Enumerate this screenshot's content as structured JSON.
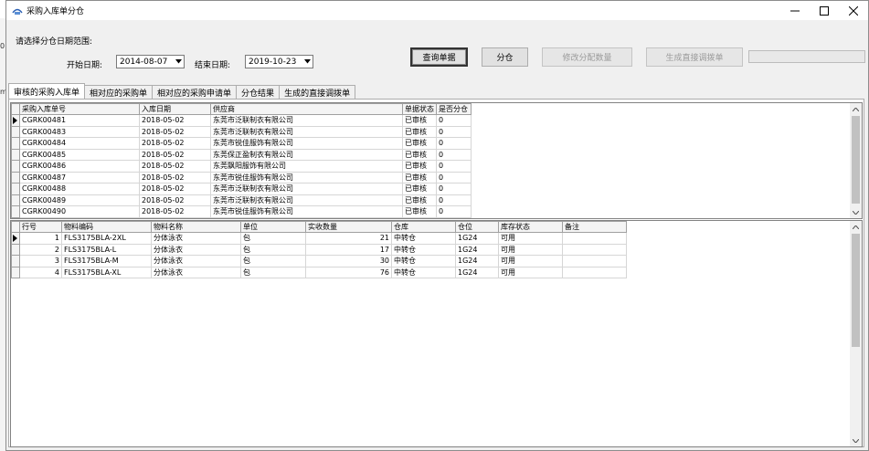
{
  "window": {
    "title": "采购入库单分仓",
    "minimize": "—",
    "maximize": "☐",
    "close": "✕"
  },
  "edge_fragments": [
    "0",
    "m"
  ],
  "filter": {
    "range_label": "请选择分仓日期范围:",
    "start_label": "开始日期:",
    "start_value": "2014-08-07",
    "end_label": "结束日期:",
    "end_value": "2019-10-23"
  },
  "buttons": {
    "query": "查询单据",
    "allocate": "分仓",
    "modify_qty": "修改分配数量",
    "generate_transfer": "生成直接调拨单"
  },
  "tabs": [
    {
      "label": "审核的采购入库单",
      "active": true
    },
    {
      "label": "相对应的采购单",
      "active": false
    },
    {
      "label": "相对应的采购申请单",
      "active": false
    },
    {
      "label": "分仓结果",
      "active": false
    },
    {
      "label": "生成的直接调拨单",
      "active": false
    }
  ],
  "receipts": {
    "columns": [
      "采购入库单号",
      "入库日期",
      "供应商",
      "单据状态",
      "是否分仓"
    ],
    "rows": [
      [
        "CGRK00481",
        "2018-05-02",
        "东莞市泛联制衣有限公司",
        "已审核",
        "0"
      ],
      [
        "CGRK00483",
        "2018-05-02",
        "东莞市泛联制衣有限公司",
        "已审核",
        "0"
      ],
      [
        "CGRK00484",
        "2018-05-02",
        "东莞市锐佳服饰有限公司",
        "已审核",
        "0"
      ],
      [
        "CGRK00485",
        "2018-05-02",
        "东莞保正盈制衣有限公司",
        "已审核",
        "0"
      ],
      [
        "CGRK00486",
        "2018-05-02",
        "东莞飘阳服饰有限公司",
        "已审核",
        "0"
      ],
      [
        "CGRK00487",
        "2018-05-02",
        "东莞市锐佳服饰有限公司",
        "已审核",
        "0"
      ],
      [
        "CGRK00488",
        "2018-05-02",
        "东莞市泛联制衣有限公司",
        "已审核",
        "0"
      ],
      [
        "CGRK00489",
        "2018-05-02",
        "东莞市泛联制衣有限公司",
        "已审核",
        "0"
      ],
      [
        "CGRK00490",
        "2018-05-02",
        "东莞市锐佳服饰有限公司",
        "已审核",
        "0"
      ]
    ]
  },
  "details": {
    "columns": [
      "行号",
      "物料编码",
      "物料名称",
      "单位",
      "实收数量",
      "仓库",
      "仓位",
      "库存状态",
      "备注"
    ],
    "rows": [
      [
        "1",
        "FLS3175BLA-2XL",
        "分体泳衣",
        "包",
        "21",
        "中转仓",
        "1G24",
        "可用",
        ""
      ],
      [
        "2",
        "FLS3175BLA-L",
        "分体泳衣",
        "包",
        "17",
        "中转仓",
        "1G24",
        "可用",
        ""
      ],
      [
        "3",
        "FLS3175BLA-M",
        "分体泳衣",
        "包",
        "30",
        "中转仓",
        "1G24",
        "可用",
        ""
      ],
      [
        "4",
        "FLS3175BLA-XL",
        "分体泳衣",
        "包",
        "76",
        "中转仓",
        "1G24",
        "可用",
        ""
      ]
    ]
  },
  "icons": {
    "app": "app-icon",
    "dropdown": "chevron-down-icon",
    "row_pointer": "current-row-arrow-icon",
    "scroll_up": "scroll-up-arrow-icon",
    "scroll_down": "scroll-down-arrow-icon"
  }
}
